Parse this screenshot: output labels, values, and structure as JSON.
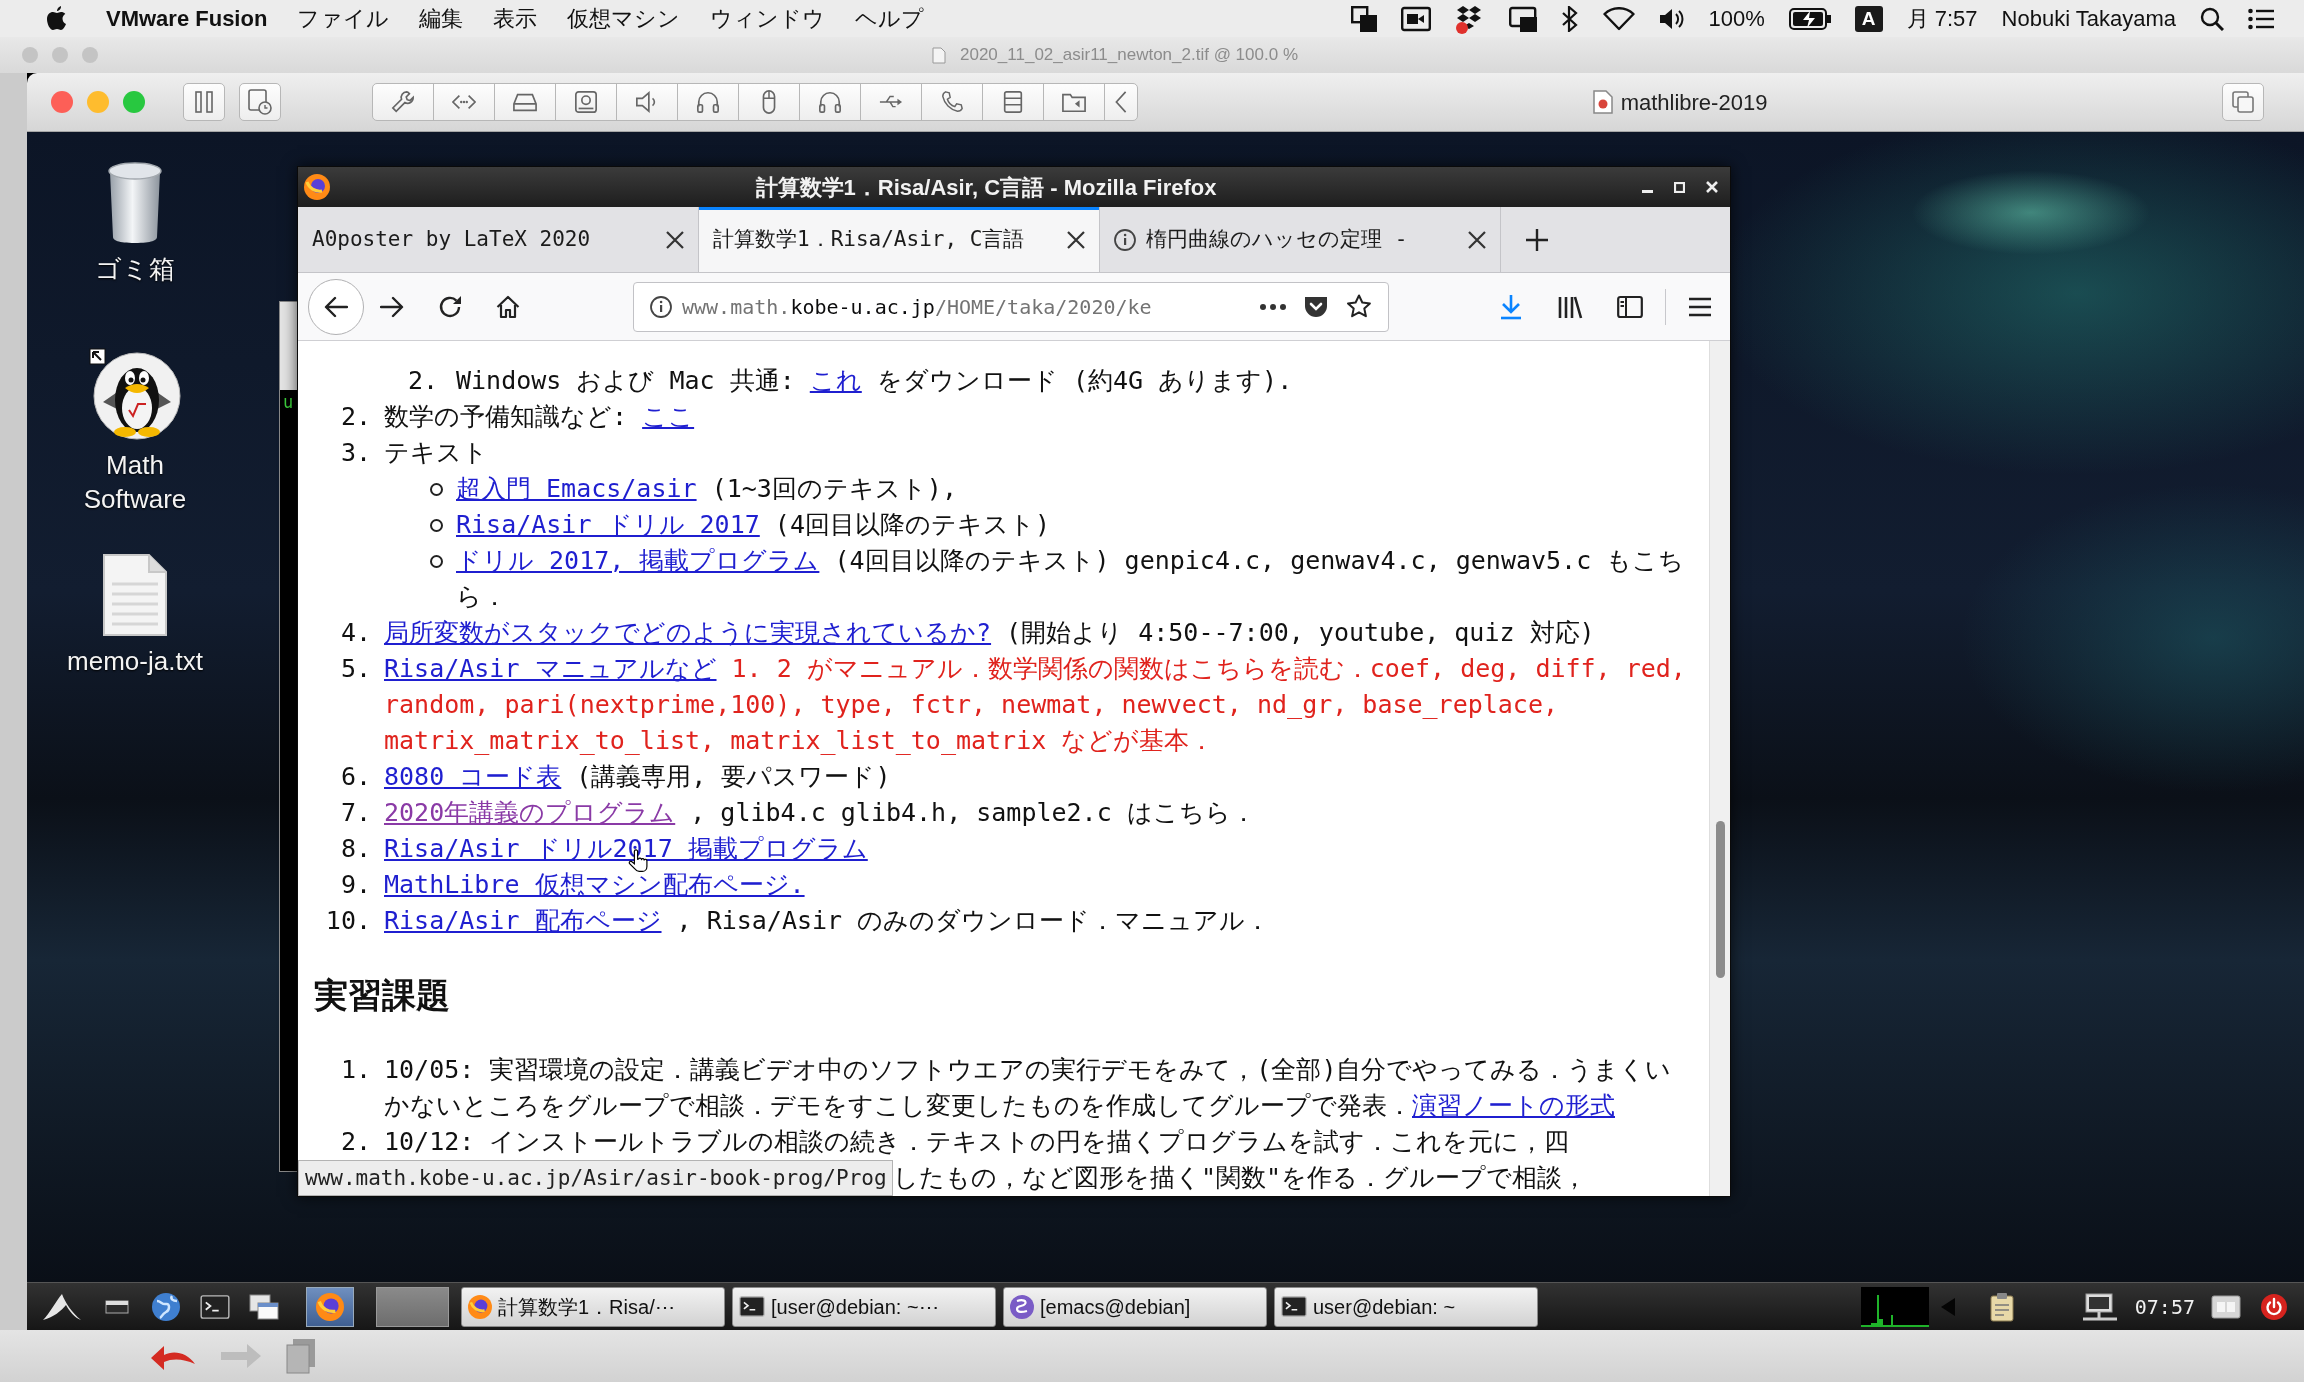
{
  "menubar": {
    "app_name": "VMware Fusion",
    "menus": [
      "ファイル",
      "編集",
      "表示",
      "仮想マシン",
      "ウィンドウ",
      "ヘルプ"
    ],
    "battery_percent": "100%",
    "input_source": "A",
    "clock": "月 7:57",
    "user": "Nobuki Takayama"
  },
  "background_window": {
    "title": "2020_11_02_asir11_newton_2.tif @ 100.0 %"
  },
  "vm_window": {
    "title": "mathlibre-2019"
  },
  "desktop_icons": [
    {
      "kind": "trash",
      "label": "ゴミ箱"
    },
    {
      "kind": "shortcut",
      "label": "Math Software"
    },
    {
      "kind": "text_file",
      "label": "memo-ja.txt"
    }
  ],
  "terminal": {
    "text": "u"
  },
  "browser": {
    "title": "計算数学1．Risa/Asir, C言語 - Mozilla Firefox",
    "tabs": [
      {
        "kind": "plain",
        "label": "A0poster by LaTeX 2020",
        "selected": false
      },
      {
        "kind": "plain",
        "label": "計算数学1．Risa/Asir, C言語",
        "selected": true
      },
      {
        "kind": "info",
        "label": "楕円曲線のハッセの定理 -",
        "selected": false
      }
    ],
    "address": {
      "prefix": "www.math.",
      "domain": "kobe-u.ac.jp",
      "path": "/HOME/taka/2020/ke"
    },
    "page": {
      "sublist": [
        {
          "number": "2.",
          "segments": [
            {
              "kind": "text",
              "text": "Windows および Mac 共通: "
            },
            {
              "kind": "link",
              "text": "これ",
              "visited": false
            },
            {
              "kind": "text",
              "text": " をダウンロード (約4G あります)."
            }
          ]
        }
      ],
      "resources": [
        {
          "number": "2.",
          "segments": [
            {
              "kind": "text",
              "text": "数学の予備知識など: "
            },
            {
              "kind": "link",
              "text": "ここ",
              "visited": false
            }
          ]
        },
        {
          "number": "3.",
          "segments": [
            {
              "kind": "text",
              "text": "テキスト"
            }
          ],
          "children": [
            {
              "segments": [
                {
                  "kind": "link",
                  "text": "超入門 Emacs/asir",
                  "visited": false
                },
                {
                  "kind": "text",
                  "text": " (1~3回のテキスト),"
                }
              ]
            },
            {
              "segments": [
                {
                  "kind": "link",
                  "text": "Risa/Asir ドリル 2017",
                  "visited": false
                },
                {
                  "kind": "text",
                  "text": " (4回目以降のテキスト)"
                }
              ]
            },
            {
              "segments": [
                {
                  "kind": "link",
                  "text": "ドリル 2017, 掲載プログラム",
                  "visited": false
                },
                {
                  "kind": "text",
                  "text": " (4回目以降のテキスト) genpic4.c, genwav4.c, genwav5.c もこちら．"
                }
              ]
            }
          ]
        },
        {
          "number": "4.",
          "segments": [
            {
              "kind": "link",
              "text": "局所変数がスタックでどのように実現されているか?",
              "visited": false
            },
            {
              "kind": "text",
              "text": " (開始より 4:50--7:00, youtube, quiz 対応)"
            }
          ]
        },
        {
          "number": "5.",
          "segments": [
            {
              "kind": "link",
              "text": "Risa/Asir マニュアルなど",
              "visited": false
            },
            {
              "kind": "note",
              "text": " 1. 2 がマニュアル．数学関係の関数はこちらを読む．coef, deg, diff, red, random, pari(nextprime,100), type, fctr, newmat, newvect, nd_gr, base_replace, matrix_matrix_to_list, matrix_list_to_matrix などが基本．"
            }
          ]
        },
        {
          "number": "6.",
          "segments": [
            {
              "kind": "link",
              "text": "8080 コード表",
              "visited": false
            },
            {
              "kind": "text",
              "text": " (講義専用, 要パスワード)"
            }
          ]
        },
        {
          "number": "7.",
          "segments": [
            {
              "kind": "link",
              "text": "2020年講義のプログラム",
              "visited": true
            },
            {
              "kind": "text",
              "text": " , glib4.c glib4.h, sample2.c はこちら．"
            }
          ]
        },
        {
          "number": "8.",
          "segments": [
            {
              "kind": "link",
              "text": "Risa/Asir ドリル2017 掲載プログラム",
              "visited": false
            }
          ]
        },
        {
          "number": "9.",
          "segments": [
            {
              "kind": "link",
              "text": "MathLibre 仮想マシン配布ページ.",
              "visited": false
            }
          ]
        },
        {
          "number": "10.",
          "segments": [
            {
              "kind": "link",
              "text": "Risa/Asir 配布ページ",
              "visited": false
            },
            {
              "kind": "text",
              "text": " , Risa/Asir のみのダウンロード．マニュアル．"
            }
          ]
        }
      ],
      "heading": "実習課題",
      "exercises": [
        {
          "number": "1.",
          "segments": [
            {
              "kind": "text",
              "text": "10/05: 実習環境の設定．講義ビデオ中のソフトウエアの実行デモをみて，(全部)自分でやってみる．うまくいかないところをグループで相談．デモをすこし変更したものを作成してグループで発表．"
            },
            {
              "kind": "link",
              "text": "演習ノートの形式",
              "visited": false
            }
          ]
        },
        {
          "number": "2.",
          "segments": [
            {
              "kind": "text",
              "text": "10/12: インストールトラブルの相談の続き．テキストの円を描くプログラムを試す．これを元に，四"
            }
          ],
          "continuation": "したもの，など図形を描く\"関数\"を作る．グループで相談，"
        }
      ]
    },
    "status_link": "www.math.kobe-u.ac.jp/Asir/asir-book-prog/Prog"
  },
  "taskbar": {
    "tasks": [
      {
        "kind": "browser",
        "label": "計算数学1．Risa/⋯"
      },
      {
        "kind": "terminal",
        "label": "[user@debian: ~⋯"
      },
      {
        "kind": "editor",
        "label": "[emacs@debian]"
      },
      {
        "kind": "terminal",
        "label": "user@debian: ~"
      }
    ],
    "clock": "07:57"
  }
}
